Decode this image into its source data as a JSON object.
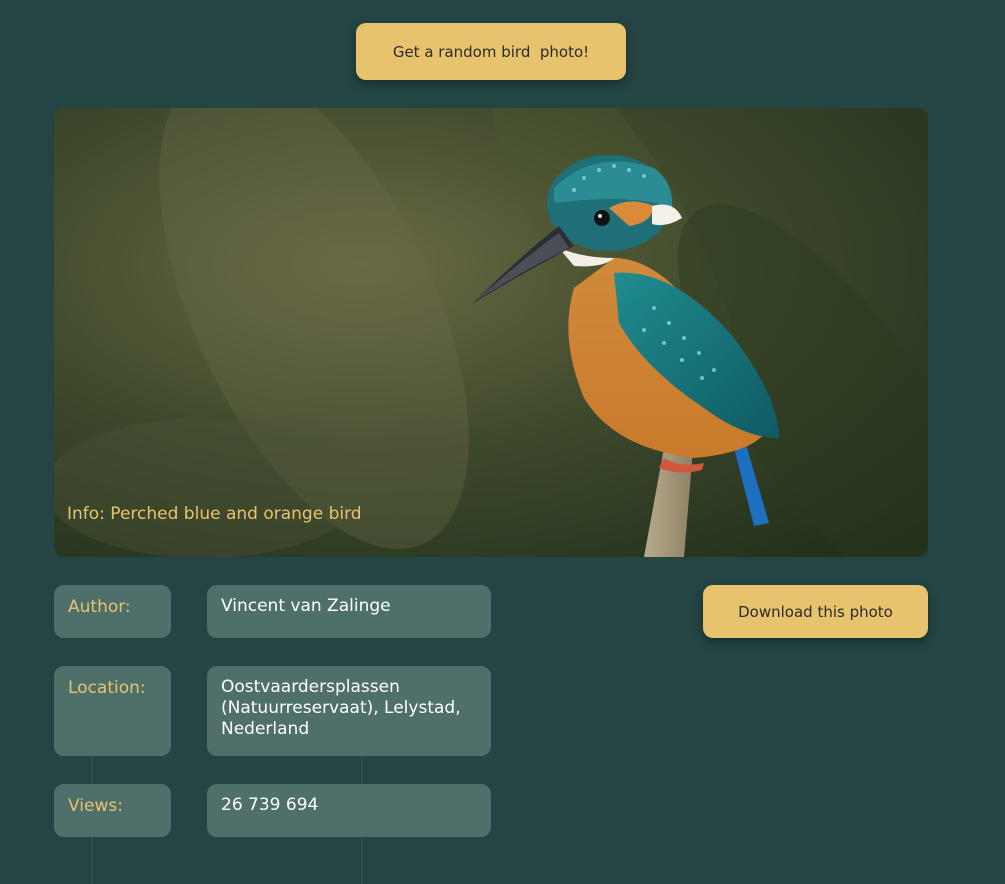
{
  "random_button": {
    "label": "Get a random bird  photo!"
  },
  "photo": {
    "info": "Info: Perched blue and orange bird",
    "image_icon": "kingfisher-photo"
  },
  "details": {
    "author_label": "Author:",
    "author_value": "Vincent van Zalinge",
    "location_label": "Location:",
    "location_value": "Oostvaardersplassen (Natuurreservaat), Lelystad, Nederland",
    "views_label": "Views:",
    "views_value": "26 739 694"
  },
  "download_button": {
    "label": "Download this photo"
  },
  "colors": {
    "background": "#244544",
    "accent": "#e8c36e",
    "card": "#4f706a"
  }
}
